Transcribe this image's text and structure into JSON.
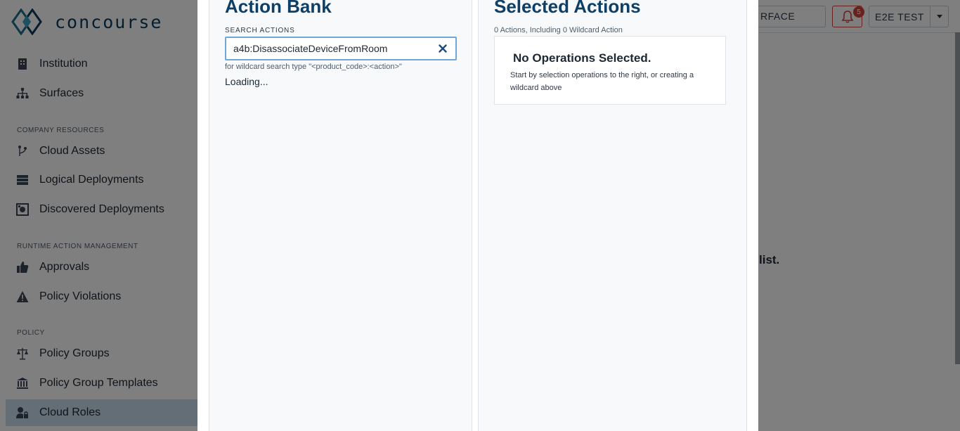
{
  "app": {
    "logo_text": "concourse",
    "brand_color": "#0b3a5c"
  },
  "sidebar": {
    "items_top": [
      {
        "label": "Institution",
        "icon": "building-icon"
      },
      {
        "label": "Surfaces",
        "icon": "sitemap-icon"
      }
    ],
    "sections": [
      {
        "label": "COMPANY RESOURCES",
        "items": [
          {
            "label": "Cloud Assets",
            "icon": "branch-icon"
          },
          {
            "label": "Logical Deployments",
            "icon": "server-icon"
          },
          {
            "label": "Discovered Deployments",
            "icon": "radar-icon"
          }
        ]
      },
      {
        "label": "RUNTIME ACTION MANAGEMENT",
        "items": [
          {
            "label": "Approvals",
            "icon": "thumbs-up-icon"
          },
          {
            "label": "Policy Violations",
            "icon": "warning-icon"
          }
        ]
      },
      {
        "label": "POLICY",
        "items": [
          {
            "label": "Policy Groups",
            "icon": "scale-icon"
          },
          {
            "label": "Policy Group Templates",
            "icon": "institution-icon"
          },
          {
            "label": "Cloud Roles",
            "icon": "user-lock-icon",
            "active": true
          }
        ]
      }
    ]
  },
  "topbar": {
    "surface_fragment": "RFACE",
    "notification_count": "5",
    "user_label": "E2E TEST",
    "alert_color": "#d0453b"
  },
  "background": {
    "text_fragment": "list."
  },
  "modal": {
    "action_bank": {
      "title": "Action Bank",
      "search_label": "SEARCH ACTIONS",
      "search_value": "a4b:DisassociateDeviceFromRoom",
      "hint": "for wildcard search type \"<product_code>:<action>\"",
      "status": "Loading..."
    },
    "selected": {
      "title": "Selected Actions",
      "count_text": "0 Actions, Including 0 Wildcard Action",
      "empty_title": "No Operations Selected.",
      "empty_body": "Start by selection operations to the right, or creating a wildcard above"
    },
    "title_color": "#0e3f66",
    "focus_color": "#6fa7dc"
  }
}
